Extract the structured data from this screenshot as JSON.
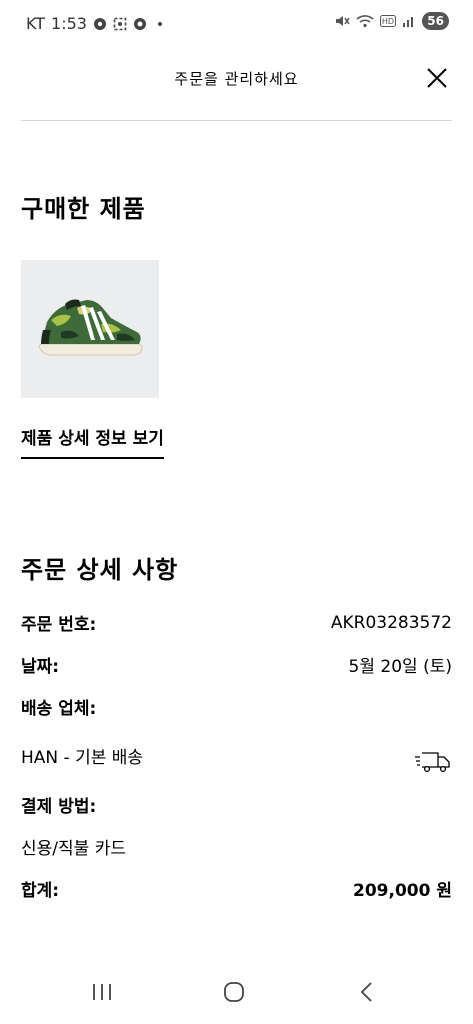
{
  "status": {
    "carrier": "KT",
    "time": "1:53",
    "battery": "56"
  },
  "header": {
    "title": "주문을 관리하세요"
  },
  "purchased": {
    "title": "구매한 제품",
    "view_details": "제품 상세 정보 보기"
  },
  "order": {
    "title": "주문 상세 사항",
    "number_label": "주문 번호:",
    "number_value": "AKR03283572",
    "date_label": "날짜:",
    "date_value": "5월 20일 (토)",
    "carrier_label": "배송 업체:",
    "carrier_value": "HAN - 기본 배송",
    "payment_label": "결제 방법:",
    "payment_value": "신용/직불 카드",
    "total_label": "합계:",
    "total_value": "209,000 원"
  },
  "icons": {
    "close": "close-icon",
    "truck": "delivery-truck-icon",
    "product": "sneaker-image"
  },
  "colors": {
    "divider": "#d6d6d6",
    "image_bg": "#ebedee"
  }
}
